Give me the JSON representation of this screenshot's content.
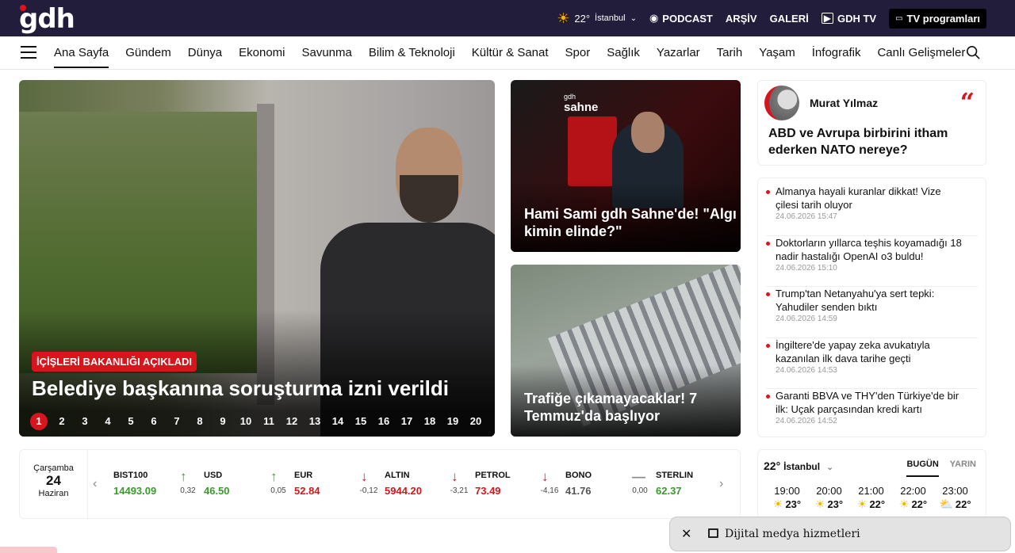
{
  "topbar": {
    "logo": "gdh",
    "weather_temp": "22°",
    "weather_city": "İstanbul",
    "podcast": "PODCAST",
    "archive": "ARŞİV",
    "gallery": "GALERİ",
    "gdh_tv": "GDH TV",
    "tv_programs": "TV programları"
  },
  "nav": {
    "items": [
      "Ana Sayfa",
      "Gündem",
      "Dünya",
      "Ekonomi",
      "Savunma",
      "Bilim & Teknoloji",
      "Kültür & Sanat",
      "Spor",
      "Sağlık",
      "Yazarlar",
      "Tarih",
      "Yaşam",
      "İnfografik",
      "Canlı Gelişmeler"
    ]
  },
  "hero": {
    "tag": "İÇİŞLERİ BAKANLIĞI AÇIKLADI",
    "title": "Belediye başkanına soruşturma izni verildi",
    "pages": [
      "1",
      "2",
      "3",
      "4",
      "5",
      "6",
      "7",
      "8",
      "9",
      "10",
      "11",
      "12",
      "13",
      "14",
      "15",
      "16",
      "17",
      "18",
      "19",
      "20"
    ]
  },
  "cards": [
    {
      "title": "Hami Sami gdh Sahne'de! \"Algı kimin elinde?\"",
      "brand_top": "gdh",
      "brand": "sahne"
    },
    {
      "title": "Trafiğe çıkamayacaklar! 7 Temmuz'da başlıyor"
    }
  ],
  "author": {
    "name": "Murat Yılmaz",
    "title": "ABD ve Avrupa birbirini itham ederken NATO nereye?"
  },
  "news": [
    {
      "title": "Almanya hayali kuranlar dikkat! Vize çilesi tarih oluyor",
      "time": "24.06.2026 15:47"
    },
    {
      "title": "Doktorların yıllarca teşhis koyamadığı 18 nadir hastalığı OpenAI o3 buldu!",
      "time": "24.06.2026 15:10"
    },
    {
      "title": "Trump'tan Netanyahu'ya sert tepki: Yahudiler senden bıktı",
      "time": "24.06.2026 14:59"
    },
    {
      "title": "İngiltere'de yapay zeka avukatıyla kazanılan ilk dava tarihe geçti",
      "time": "24.06.2026 14:53"
    },
    {
      "title": "Garanti BBVA ve THY'den Türkiye'de bir ilk: Uçak parçasından kredi kartı",
      "time": "24.06.2026 14:52"
    }
  ],
  "market": {
    "day": "Çarşamba",
    "date": "24",
    "month": "Haziran",
    "tickers": [
      {
        "label": "BIST100",
        "value": "14493.09",
        "change": "0,32",
        "dir": "up"
      },
      {
        "label": "USD",
        "value": "46.50",
        "change": "0,05",
        "dir": "up"
      },
      {
        "label": "EUR",
        "value": "52.84",
        "change": "-0,12",
        "dir": "down"
      },
      {
        "label": "ALTIN",
        "value": "5944.20",
        "change": "-3,21",
        "dir": "down"
      },
      {
        "label": "PETROL",
        "value": "73.49",
        "change": "-4,16",
        "dir": "down"
      },
      {
        "label": "BONO",
        "value": "41.76",
        "change": "0,00",
        "dir": "flat"
      },
      {
        "label": "STERLIN",
        "value": "62.37",
        "change": "",
        "dir": "up"
      }
    ]
  },
  "weather": {
    "temp": "22°",
    "city": "İstanbul",
    "tab_today": "BUGÜN",
    "tab_tomorrow": "YARIN",
    "hours": [
      {
        "h": "19:00",
        "t": "23°"
      },
      {
        "h": "20:00",
        "t": "23°"
      },
      {
        "h": "21:00",
        "t": "22°"
      },
      {
        "h": "22:00",
        "t": "22°"
      },
      {
        "h": "23:00",
        "t": "22°"
      }
    ]
  },
  "digital": {
    "label": "Dijital medya hizmetleri"
  },
  "colors": {
    "brand_red": "#d8141c",
    "topbar_bg": "#211d3b",
    "up": "#3a9a2c",
    "down": "#d8141c"
  }
}
